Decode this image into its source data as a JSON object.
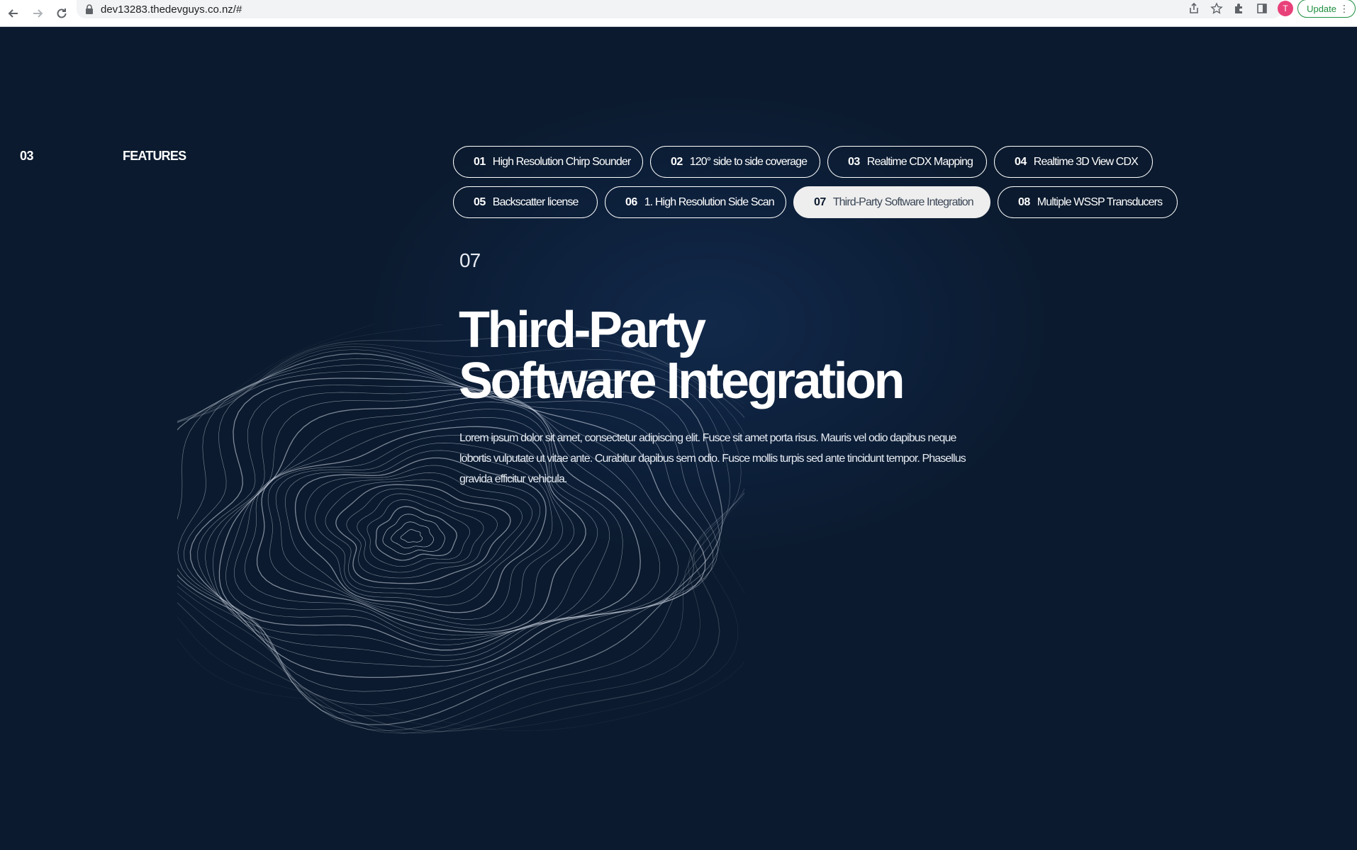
{
  "browser": {
    "url": "dev13283.thedevguys.co.nz/#",
    "avatar_letter": "T",
    "update_label": "Update"
  },
  "section": {
    "number": "03",
    "title": "FEATURES"
  },
  "tabs": [
    {
      "num": "01",
      "label": "High Resolution Chirp Sounder",
      "active": false
    },
    {
      "num": "02",
      "label": "120° side to side coverage",
      "active": false
    },
    {
      "num": "03",
      "label": "Realtime CDX Mapping",
      "active": false
    },
    {
      "num": "04",
      "label": "Realtime 3D View CDX",
      "active": false
    },
    {
      "num": "05",
      "label": "Backscatter license",
      "active": false
    },
    {
      "num": "06",
      "label": "1. High Resolution Side Scan",
      "active": false
    },
    {
      "num": "07",
      "label": "Third-Party Software Integration",
      "active": true
    },
    {
      "num": "08",
      "label": "Multiple WSSP Transducers",
      "active": false
    }
  ],
  "content": {
    "number": "07",
    "title_line1": "Third-Party",
    "title_line2": "Software Integration",
    "body": "Lorem ipsum dolor sit amet, consectetur adipiscing elit. Fusce sit amet porta risus. Mauris vel odio dapibus neque lobortis vulputate ut vitae ante. Curabitur dapibus sem odio. Fusce mollis turpis sed ante tincidunt tempor. Phasellus gravida efficitur vehicula."
  },
  "colors": {
    "background": "#0b1a2e",
    "text": "#ffffff",
    "active_tab_bg": "#eeeeee"
  }
}
